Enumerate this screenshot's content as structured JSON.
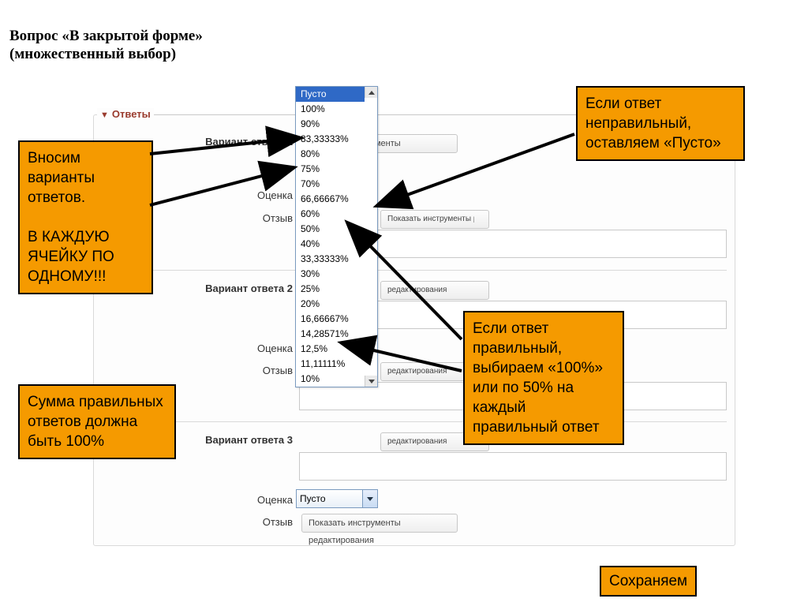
{
  "title_line1": "Вопрос «В закрытой форме»",
  "title_line2": "(множественный выбор)",
  "section_header": "Ответы",
  "labels": {
    "variant1": "Вариант ответа 1",
    "variant2": "Вариант ответа 2",
    "variant3": "Вариант ответа 3",
    "grade": "Оценка",
    "feedback": "Отзыв",
    "tools": "Показать инструменты редактирования"
  },
  "select": {
    "current": "Пусто",
    "current_closed": "Пусто",
    "options": [
      "Пусто",
      "100%",
      "90%",
      "83,33333%",
      "80%",
      "75%",
      "70%",
      "66,66667%",
      "60%",
      "50%",
      "40%",
      "33,33333%",
      "30%",
      "25%",
      "20%",
      "16,66667%",
      "14,28571%",
      "12,5%",
      "11,11111%",
      "10%"
    ]
  },
  "callouts": {
    "left_top": "Вносим варианты ответов.",
    "left_top_strong": "В КАЖДУЮ ЯЧЕЙКУ ПО ОДНОМУ!!!",
    "left_bottom": "Сумма правильных ответов должна быть 100%",
    "right_top": "Если ответ неправильный, оставляем «Пусто»",
    "right_mid": "Если ответ правильный, выбираем «100%» или по 50% на каждый правильный ответ",
    "save": "Сохраняем"
  }
}
